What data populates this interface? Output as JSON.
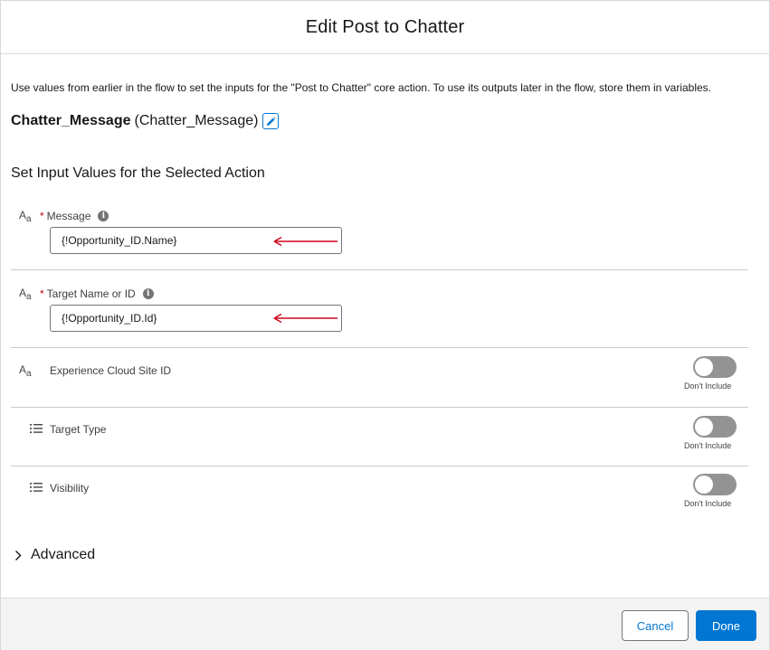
{
  "header": {
    "title": "Edit Post to Chatter"
  },
  "intro": {
    "text": "Use values from earlier in the flow to set the inputs for the \"Post to Chatter\" core action. To use its outputs later in the flow, store them in variables."
  },
  "action": {
    "label": "Chatter_Message",
    "api_name": "(Chatter_Message)"
  },
  "section_title": "Set Input Values for the Selected Action",
  "fields": {
    "message": {
      "type_icon": "text-type-icon",
      "type_label_main": "A",
      "type_label_sub": "a",
      "required_mark": "*",
      "label": "Message",
      "value": "{!Opportunity_ID.Name}"
    },
    "target": {
      "type_icon": "text-type-icon",
      "type_label_main": "A",
      "type_label_sub": "a",
      "required_mark": "*",
      "label": "Target Name or ID",
      "value": "{!Opportunity_ID.Id}"
    },
    "experience": {
      "type_icon": "text-type-icon",
      "type_label_main": "A",
      "type_label_sub": "a",
      "label": "Experience Cloud Site ID",
      "toggle_label": "Don't Include"
    },
    "target_type": {
      "type_icon": "picklist-icon",
      "label": "Target Type",
      "toggle_label": "Don't Include"
    },
    "visibility": {
      "type_icon": "picklist-icon",
      "label": "Visibility",
      "toggle_label": "Don't Include"
    }
  },
  "advanced": {
    "label": "Advanced"
  },
  "footer": {
    "cancel_label": "Cancel",
    "done_label": "Done"
  },
  "colors": {
    "brand": "#0176d3",
    "required": "#ba0517",
    "annotation_arrow": "#d0021b",
    "toggle_off": "#939393"
  }
}
